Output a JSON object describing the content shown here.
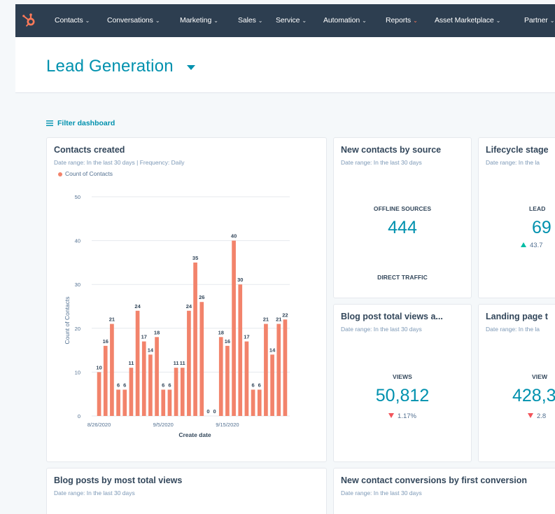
{
  "nav": {
    "items": [
      {
        "label": "Contacts"
      },
      {
        "label": "Conversations"
      },
      {
        "label": "Marketing"
      },
      {
        "label": "Sales"
      },
      {
        "label": "Service"
      },
      {
        "label": "Automation"
      },
      {
        "label": "Reports"
      },
      {
        "label": "Asset Marketplace"
      },
      {
        "label": "Partner"
      }
    ],
    "active": "Reports"
  },
  "header": {
    "title": "Lead Generation"
  },
  "filter": {
    "label": "Filter dashboard"
  },
  "contacts_card": {
    "title": "Contacts created",
    "subtitle": "Date range: In the last 30 days  |  Frequency: Daily",
    "legend": "Count of Contacts"
  },
  "source_card": {
    "title": "New contacts by source",
    "subtitle": "Date range: In the last 30 days",
    "label1": "OFFLINE SOURCES",
    "value1": "444",
    "label2": "DIRECT TRAFFIC"
  },
  "lifecycle_card": {
    "title": "Lifecycle stage",
    "subtitle": "Date range: In the la",
    "label": "LEAD",
    "value": "69",
    "change": "43.7"
  },
  "blog_views_card": {
    "title": "Blog post total views a...",
    "subtitle": "Date range: In the last 30 days",
    "label": "VIEWS",
    "value": "50,812",
    "change": "1.17%"
  },
  "landing_card": {
    "title": "Landing page t",
    "subtitle": "Date range: In the la",
    "label": "VIEW",
    "value": "428,3",
    "change": "2.8"
  },
  "blog_posts_card": {
    "title": "Blog posts by most total views",
    "subtitle": "Date range: In the last 30 days"
  },
  "conversions_card": {
    "title": "New contact conversions by first conversion",
    "subtitle": "Date range: In the last 30 days"
  },
  "colors": {
    "nav_bg": "#2d3e50",
    "accent": "#0091ae",
    "bar": "#f2836b",
    "up": "#00bda5",
    "down": "#f2545b"
  },
  "chart_data": {
    "type": "bar",
    "title": "Contacts created",
    "xlabel": "Create date",
    "ylabel": "Count of Contacts",
    "ylim": [
      0,
      50
    ],
    "yticks": [
      0,
      10,
      20,
      30,
      40,
      50
    ],
    "xtick_labels": [
      "8/26/2020",
      "9/5/2020",
      "9/15/2020"
    ],
    "xtick_indices": [
      0,
      10,
      20
    ],
    "series": [
      {
        "name": "Count of Contacts",
        "values": [
          10,
          16,
          21,
          6,
          6,
          11,
          24,
          17,
          14,
          18,
          6,
          6,
          11,
          11,
          24,
          35,
          26,
          0,
          0,
          18,
          16,
          40,
          30,
          17,
          6,
          6,
          21,
          14,
          21,
          22
        ]
      }
    ]
  }
}
